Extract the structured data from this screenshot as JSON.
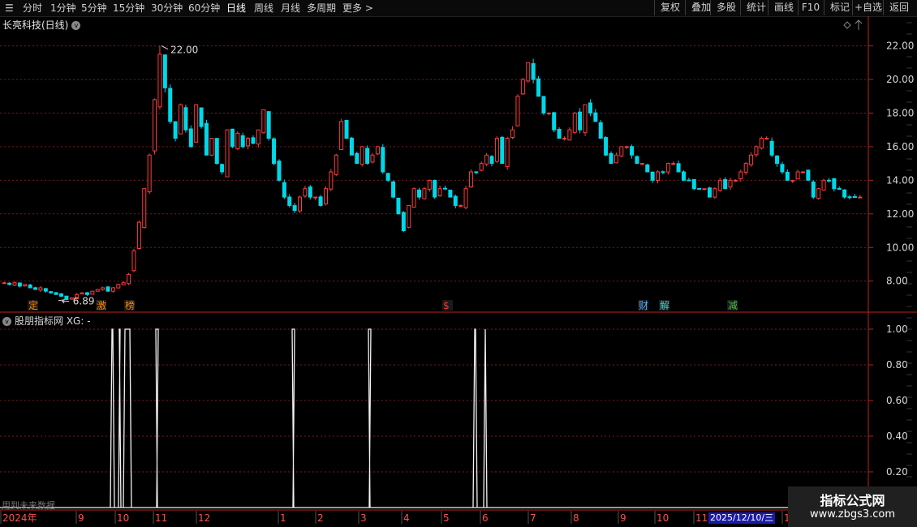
{
  "toolbar": {
    "timeframes": [
      {
        "label": "分时"
      },
      {
        "label": "1分钟"
      },
      {
        "label": "5分钟"
      },
      {
        "label": "15分钟"
      },
      {
        "label": "30分钟"
      },
      {
        "label": "60分钟"
      },
      {
        "label": "日线"
      },
      {
        "label": "周线"
      },
      {
        "label": "月线"
      },
      {
        "label": "多周期"
      },
      {
        "label": "更多 >"
      }
    ],
    "active_timeframe": "日线",
    "right_buttons": [
      {
        "label": "复权"
      },
      {
        "label": "叠加"
      },
      {
        "label": "多股"
      },
      {
        "label": "统计"
      },
      {
        "label": "画线"
      },
      {
        "label": "F10"
      },
      {
        "label": "标记"
      },
      {
        "label": "+自选"
      },
      {
        "label": "返回"
      }
    ]
  },
  "main_panel": {
    "title": "长亮科技(日线)",
    "y_axis_labels": [
      "22.00",
      "20.00",
      "18.00",
      "16.00",
      "14.00",
      "12.00",
      "10.00",
      "8.00"
    ],
    "high_label": "22.00",
    "low_label": "6.89",
    "event_markers": [
      {
        "label": "定",
        "color": "#ff8800"
      },
      {
        "label": "激",
        "color": "#ff8800"
      },
      {
        "label": "榜",
        "color": "#ff8800"
      },
      {
        "label": "$",
        "color": "#ff3030"
      },
      {
        "label": "财",
        "color": "#4aa8ff"
      },
      {
        "label": "解",
        "color": "#40d0d0"
      },
      {
        "label": "减",
        "color": "#40c040"
      }
    ]
  },
  "indicator_panel": {
    "title": "股朋指标网 XG: -",
    "y_axis_labels": [
      "1.00",
      "0.80",
      "0.60",
      "0.40",
      "0.20"
    ],
    "future_data_note": "用到未来数据"
  },
  "x_axis": {
    "labels": [
      "2024年",
      "9",
      "10",
      "11",
      "12",
      "1",
      "2",
      "3",
      "4",
      "5",
      "6",
      "7",
      "8",
      "9",
      "10",
      "11",
      "12"
    ],
    "cursor_date": "2025/12/10/三"
  },
  "watermark": {
    "title": "指标公式网",
    "url": "www.zbgs3.com"
  },
  "colors": {
    "up": "#ff3c3c",
    "down": "#00d8e8",
    "grid": "#7a1a1a",
    "axis": "#c02020"
  },
  "chart_data": {
    "type": "candlestick",
    "ylim": [
      6.2,
      22.8
    ],
    "indicator_ylim": [
      0,
      1
    ],
    "close_series": [
      7.9,
      7.8,
      7.9,
      7.7,
      7.8,
      7.6,
      7.5,
      7.6,
      7.4,
      7.3,
      7.2,
      7.1,
      6.9,
      7.0,
      7.2,
      7.3,
      7.2,
      7.4,
      7.5,
      7.6,
      7.4,
      7.6,
      7.8,
      7.9,
      8.4,
      9.8,
      11.5,
      13.5,
      15.5,
      18.8,
      21.5,
      19.5,
      17.5,
      16.5,
      18.5,
      17.0,
      16.0,
      18.5,
      17.2,
      15.5,
      16.5,
      15.0,
      14.5,
      17.0,
      16.0,
      16.8,
      16.0,
      16.5,
      16.2,
      17.0,
      18.2,
      16.5,
      15.0,
      14.0,
      13.0,
      12.5,
      12.2,
      13.0,
      13.5,
      13.0,
      13.0,
      12.5,
      13.5,
      14.5,
      15.5,
      17.5,
      16.5,
      15.5,
      15.0,
      16.0,
      15.0,
      15.5,
      16.0,
      14.5,
      14.0,
      13.0,
      12.0,
      11.0,
      12.5,
      13.5,
      13.0,
      13.5,
      14.0,
      13.0,
      13.5,
      13.5,
      13.0,
      12.5,
      12.5,
      13.5,
      14.5,
      14.5,
      15.0,
      15.5,
      15.0,
      16.5,
      15.0,
      16.5,
      17.0,
      19.0,
      20.0,
      21.0,
      20.0,
      19.0,
      18.0,
      18.0,
      17.0,
      16.5,
      16.5,
      17.0,
      18.0,
      17.0,
      18.5,
      18.0,
      17.5,
      16.5,
      15.5,
      15.0,
      15.5,
      16.0,
      16.0,
      15.5,
      15.0,
      15.0,
      14.5,
      14.0,
      14.5,
      14.5,
      15.0,
      15.0,
      14.5,
      14.0,
      14.0,
      13.5,
      13.5,
      13.5,
      13.0,
      13.5,
      14.0,
      13.5,
      14.0,
      14.0,
      14.5,
      15.0,
      15.5,
      16.0,
      16.5,
      16.5,
      15.5,
      15.0,
      14.5,
      14.0,
      14.0,
      14.5,
      14.5,
      14.0,
      13.0,
      13.5,
      14.0,
      14.0,
      13.5,
      13.5,
      13.0,
      13.0,
      13.0,
      13.0
    ],
    "high": 22.0,
    "low": 6.89,
    "signal_periods": [
      [
        136,
        141
      ],
      [
        146,
        149
      ],
      [
        152,
        162
      ],
      [
        193,
        194
      ],
      [
        361,
        362
      ],
      [
        455,
        456
      ],
      [
        583,
        588
      ],
      [
        596,
        600
      ]
    ]
  }
}
